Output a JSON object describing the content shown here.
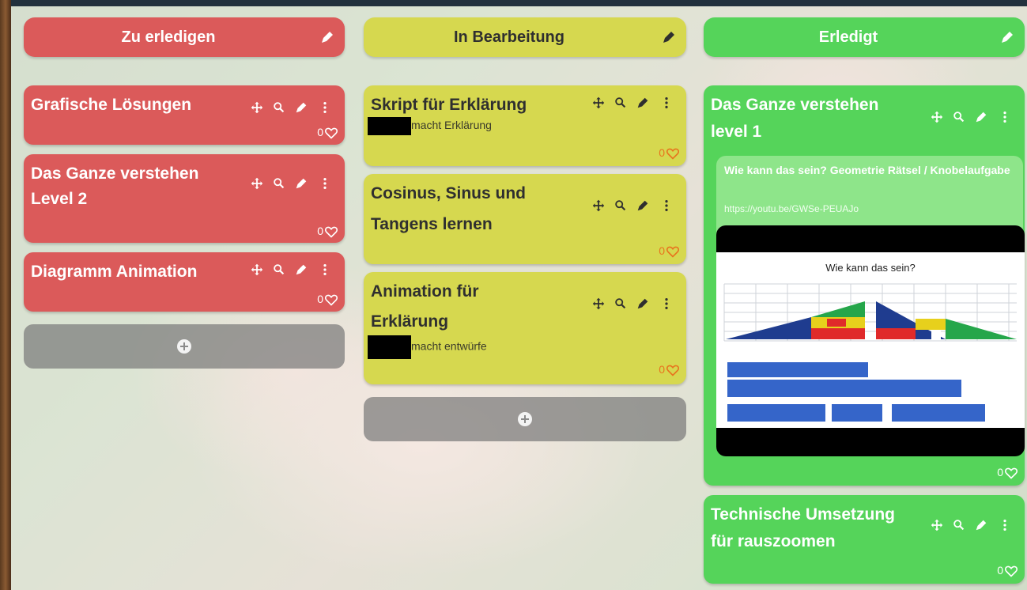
{
  "columns": [
    {
      "title": "Zu erledigen",
      "cards": [
        {
          "title_lines": [
            "Grafische Lösungen"
          ],
          "likes": "0"
        },
        {
          "title_lines": [
            "Das Ganze verstehen",
            "Level 2"
          ],
          "likes": "0"
        },
        {
          "title_lines": [
            "Diagramm Animation"
          ],
          "likes": "0"
        }
      ]
    },
    {
      "title": "In Bearbeitung",
      "cards": [
        {
          "title_lines": [
            "Skript für Erklärung"
          ],
          "description": "macht Erklärung",
          "likes": "0"
        },
        {
          "title_lines": [
            "Cosinus, Sinus und",
            "Tangens lernen"
          ],
          "likes": "0"
        },
        {
          "title_lines": [
            "Animation für",
            "Erklärung"
          ],
          "description": "macht entwürfe",
          "likes": "0"
        }
      ]
    },
    {
      "title": "Erledigt",
      "cards": [
        {
          "title_lines": [
            "Das Ganze verstehen",
            "level 1"
          ],
          "likes": "0",
          "attachment": {
            "title": "Wie kann das sein? Geometrie Rätsel / Knobelaufgabe",
            "url": "https://youtu.be/GWSe-PEUAJo",
            "video_caption": "Wie kann das sein?"
          }
        },
        {
          "title_lines": [
            "Technische Umsetzung",
            "für rauszoomen"
          ],
          "likes": "0"
        }
      ]
    }
  ],
  "icons": [
    "edit-icon",
    "move-icon",
    "search-icon",
    "more-icon",
    "heart-icon",
    "add-icon"
  ],
  "colors": {
    "todo": "#db5a5a",
    "doing": "#d6d84f",
    "done": "#55d45a",
    "likes_on_yellow": "#e8741e"
  }
}
